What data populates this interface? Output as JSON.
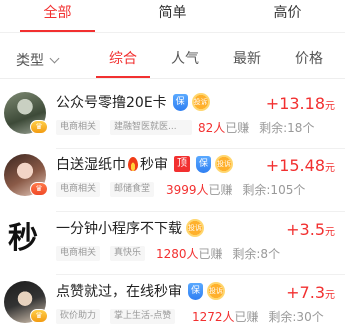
{
  "top_tabs": [
    {
      "label": "全部"
    },
    {
      "label": "简单"
    },
    {
      "label": "高价"
    }
  ],
  "filter": {
    "type_label": "类型",
    "sort_tabs": [
      {
        "label": "综合"
      },
      {
        "label": "人气"
      },
      {
        "label": "最新"
      },
      {
        "label": "价格"
      }
    ]
  },
  "tasks": [
    {
      "title": "公众号零撸20E卡",
      "badges": [
        "保",
        "投诉"
      ],
      "tags": [
        "电商相关",
        "建融智医就医..."
      ],
      "earned_count": "82人",
      "earned_suffix": "已赚",
      "remaining": "剩余:18个",
      "reward_amount": "+13.18",
      "reward_unit": "元"
    },
    {
      "title": "白送湿纸巾",
      "title_suffix": "秒审",
      "badges": [
        "顶",
        "保",
        "投诉"
      ],
      "tags": [
        "电商相关",
        "邮储食堂"
      ],
      "earned_count": "3999人",
      "earned_suffix": "已赚",
      "remaining": "剩余:105个",
      "reward_amount": "+15.48",
      "reward_unit": "元"
    },
    {
      "title": "一分钟小程序不下载",
      "badges": [
        "投诉"
      ],
      "tags": [
        "电商相关",
        "真快乐"
      ],
      "earned_count": "1280人",
      "earned_suffix": "已赚",
      "remaining": "剩余:8个",
      "reward_amount": "+3.5",
      "reward_unit": "元",
      "avatar_glyph": "秒"
    },
    {
      "title": "点赞就过，在线秒审",
      "badges": [
        "保",
        "投诉"
      ],
      "tags": [
        "砍价助力",
        "掌上生活-点赞"
      ],
      "earned_count": "1272人",
      "earned_suffix": "已赚",
      "remaining": "剩余:30个",
      "reward_amount": "+7.3",
      "reward_unit": "元"
    }
  ],
  "colors": {
    "accent": "#f23030",
    "tag_bg": "#f6f6f6",
    "muted_text": "#999999"
  }
}
